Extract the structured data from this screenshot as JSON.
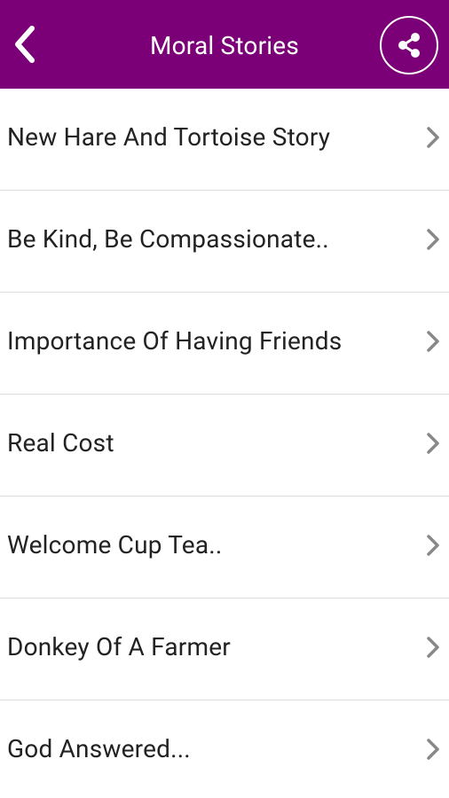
{
  "app": {
    "title": "Moral Stories",
    "brand_color": "#7b0077",
    "header_text_color": "#ffffff"
  },
  "toolbar": {
    "back_icon": "chevron-left-icon",
    "share_icon": "share-icon"
  },
  "stories": [
    {
      "label": "New Hare And Tortoise Story"
    },
    {
      "label": "Be Kind, Be Compassionate.."
    },
    {
      "label": "Importance Of Having Friends"
    },
    {
      "label": "Real Cost"
    },
    {
      "label": "Welcome Cup Tea.."
    },
    {
      "label": "Donkey Of A Farmer"
    },
    {
      "label": "God Answered..."
    }
  ]
}
